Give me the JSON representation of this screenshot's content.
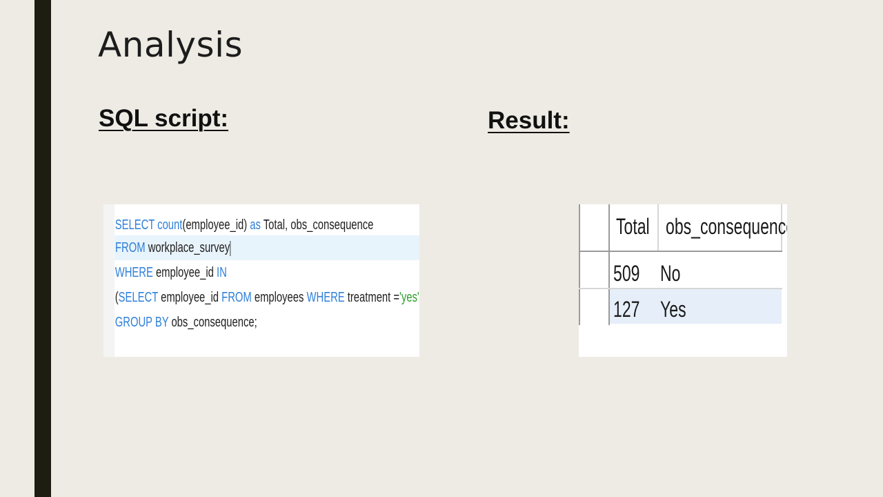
{
  "slide": {
    "title": "Analysis",
    "sql_heading": "SQL script:",
    "result_heading": "Result:"
  },
  "sql_code": {
    "line1": {
      "kw1": "SELECT",
      "fn": "count",
      "mid": "(employee_id)",
      "kw2": "as",
      "rest": "Total, obs_consequence"
    },
    "line2": {
      "kw": "FROM",
      "rest": "workplace_survey"
    },
    "line3": {
      "kw1": "WHERE",
      "mid": "employee_id",
      "kw2": "IN"
    },
    "line4": {
      "open": "(",
      "kw1": "SELECT",
      "mid1": "employee_id",
      "kw2": "FROM",
      "mid2": "employees",
      "kw3": "WHERE",
      "mid3": "treatment =",
      "str": "'yes'",
      "close": ")"
    },
    "line5": {
      "kw": "GROUP BY",
      "rest": "obs_consequence;"
    }
  },
  "result_grid": {
    "columns": [
      "Total",
      "obs_consequence"
    ],
    "rows": [
      [
        "509",
        "No"
      ],
      [
        "127",
        "Yes"
      ]
    ]
  },
  "colors": {
    "background": "#eeebe4",
    "sidebar": "#1d1d12",
    "keyword": "#2e7fd9",
    "string": "#2a9d2a",
    "row_highlight": "#e6eef9"
  }
}
